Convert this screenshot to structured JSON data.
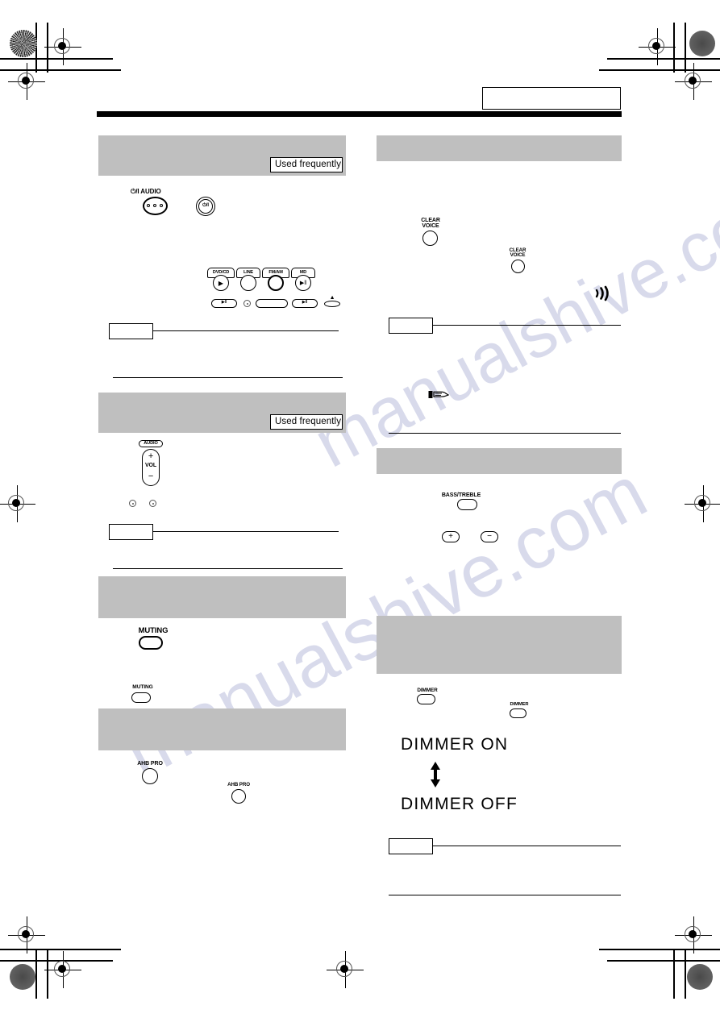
{
  "document": {
    "type": "scanned-product-manual-page",
    "page_header_box_text": "",
    "watermark_text": "manualshive.com"
  },
  "badges": {
    "used_frequently": "Used frequently"
  },
  "left_column": {
    "sections": [
      {
        "id": "power",
        "heading": "",
        "badge": "Used frequently",
        "controls": {
          "remote_label": "⏻/I  AUDIO",
          "unit_power_label": "⏻/I"
        }
      },
      {
        "id": "source-select",
        "source_buttons": [
          {
            "label": "DVD/CD",
            "glyph": "▶",
            "emphasis": false
          },
          {
            "label": "LINE",
            "glyph": "",
            "emphasis": false
          },
          {
            "label": "FM/AM",
            "glyph": "",
            "emphasis": true
          },
          {
            "label": "MD",
            "glyph": "▶‖",
            "emphasis": false
          }
        ],
        "panel_keys": [
          {
            "glyph": "▶‖"
          },
          {
            "glyph": ""
          },
          {
            "glyph": ""
          },
          {
            "glyph": "▶‖"
          },
          {
            "glyph": "▲"
          }
        ],
        "note_box_text": ""
      },
      {
        "id": "volume",
        "heading": "",
        "badge": "Used frequently",
        "controls": {
          "group_label": "AUDIO",
          "plus": "+",
          "vol": "VOL",
          "minus": "−"
        },
        "note_box_text": ""
      },
      {
        "id": "muting",
        "heading": "",
        "controls": {
          "remote_button": "MUTING",
          "unit_button": "MUTING"
        }
      },
      {
        "id": "ahb-pro",
        "heading": "",
        "controls": {
          "remote_button": "AHB PRO",
          "unit_button": "AHB PRO"
        }
      }
    ]
  },
  "right_column": {
    "sections": [
      {
        "id": "clear-voice",
        "heading": "",
        "controls": {
          "remote_button": "CLEAR\nVOICE",
          "remote_button_line1": "CLEAR",
          "remote_button_line2": "VOICE",
          "unit_button_line1": "CLEAR",
          "unit_button_line2": "VOICE",
          "indicator_icon": "sound-wave"
        },
        "note_box_text": "",
        "hint_icon": "pointing-hand"
      },
      {
        "id": "bass-treble",
        "heading": "",
        "controls": {
          "select_button": "BASS/TREBLE",
          "plus": "+",
          "minus": "−"
        }
      },
      {
        "id": "dimmer",
        "heading": "",
        "controls": {
          "remote_button": "DIMMER",
          "unit_button": "DIMMER"
        },
        "display_states": {
          "on": "DIMMER ON",
          "toggle_icon": "up-down-arrow",
          "off": "DIMMER OFF"
        },
        "note_box_text": ""
      }
    ]
  },
  "colors": {
    "section_bar": "#bfbfbf",
    "rule": "#000000",
    "watermark": "#b9bcdc"
  }
}
